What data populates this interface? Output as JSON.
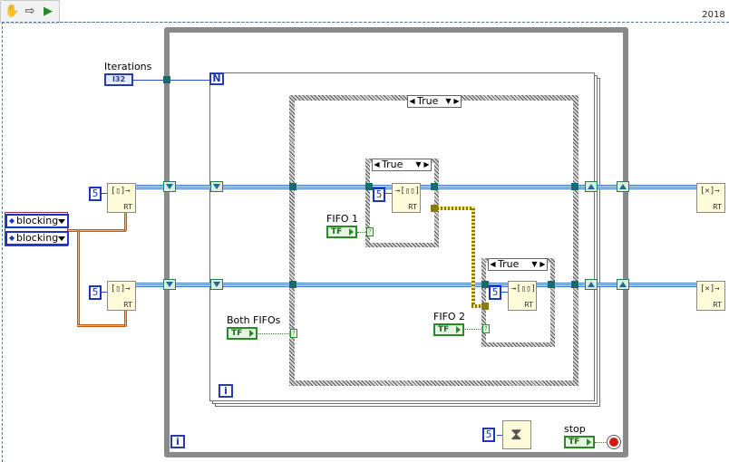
{
  "toolbar": {
    "tools": [
      "hand-icon",
      "arrow-icon",
      "run-icon"
    ],
    "year": "2018"
  },
  "while_loop": {
    "iteration": "i",
    "stop_label": "stop"
  },
  "for_loop": {
    "count_terminal": "N",
    "iteration": "i"
  },
  "controls": {
    "iterations_label": "Iterations",
    "iterations_type": "I32",
    "enum_values": [
      "blocking",
      "blocking"
    ],
    "both_fifos_label": "Both FIFOs",
    "fifo1_label": "FIFO 1",
    "fifo2_label": "FIFO 2",
    "bool_type": "TF"
  },
  "cases": {
    "outer": "True",
    "inner1": "True",
    "inner2": "True"
  },
  "constants": {
    "depth": "5"
  },
  "nodes": {
    "rt_label": "RT"
  },
  "colors": {
    "int_wire": "#1a36c0",
    "fifo_wire": "#3a6fcf",
    "enum_wire": "#c05a10",
    "bool_wire": "#2a8a2a",
    "error_wire": "#8a7a10"
  }
}
